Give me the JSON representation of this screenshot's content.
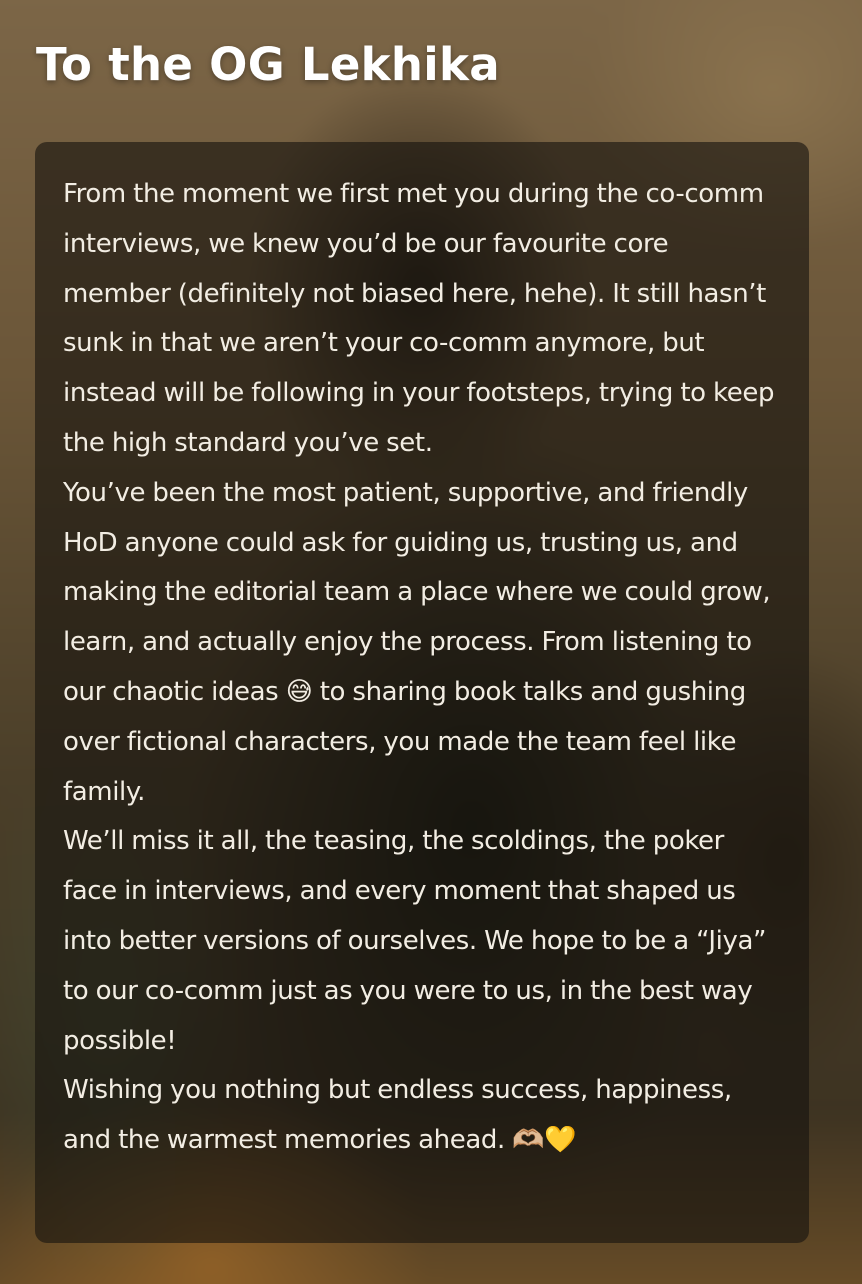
{
  "title": "To the OG Lekhika",
  "message": {
    "paragraphs": [
      "From the moment we first met you during the co-comm interviews, we knew you’d be our favourite core member (definitely not biased here, hehe). It still hasn’t sunk in that we aren’t your co-comm anymore, but instead will be following in your footsteps, trying to keep the high standard you’ve set.",
      "You’ve been the most patient, supportive, and friendly HoD anyone could ask for guiding us, trusting us, and making the editorial team a place where we could grow, learn, and actually enjoy the process. From listening to our chaotic ideas 😅 to sharing book talks and gushing over fictional characters, you made the team feel like family.",
      "We’ll miss it all, the teasing, the scoldings, the poker face in interviews, and every moment that shaped us into better versions of ourselves. We hope to be a “Jiya” to our co-comm just as you were to us, in the best way possible!",
      "Wishing you nothing but endless success, happiness, and the warmest memories ahead. 🫶🏼💛"
    ]
  }
}
